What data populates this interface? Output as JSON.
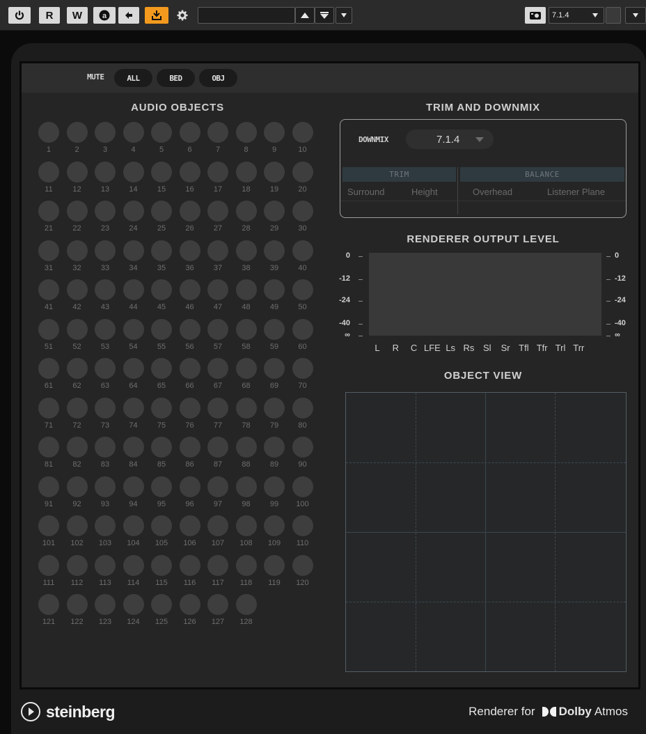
{
  "toolbar": {
    "power_icon": "power-icon",
    "read_label": "R",
    "write_label": "W",
    "automation_icon": "a-circle-icon",
    "side_chain_icon": "arrow-left-icon",
    "monitor_icon": "routing-icon",
    "settings_icon": "gear-icon",
    "preset_value": "",
    "format_value": "7.1.4",
    "camera_icon": "snapshot-icon"
  },
  "mute": {
    "label": "MUTE",
    "buttons": [
      "ALL",
      "BED",
      "OBJ"
    ]
  },
  "audio_objects": {
    "title": "AUDIO OBJECTS",
    "count": 128,
    "columns": 10
  },
  "trim_downmix": {
    "title": "TRIM AND DOWNMIX",
    "downmix_label": "DOWNMIX",
    "downmix_value": "7.1.4",
    "trim_header": "TRIM",
    "balance_header": "BALANCE",
    "trim_columns": [
      "Surround",
      "Height"
    ],
    "balance_columns": [
      "Overhead",
      "Listener Plane"
    ]
  },
  "renderer_output": {
    "title": "RENDERER OUTPUT LEVEL",
    "scale": [
      "0",
      "-12",
      "-24",
      "-40",
      "∞"
    ],
    "channels": [
      "L",
      "R",
      "C",
      "LFE",
      "Ls",
      "Rs",
      "Sl",
      "Sr",
      "Tfl",
      "Tfr",
      "Trl",
      "Trr"
    ]
  },
  "object_view": {
    "title": "OBJECT VIEW"
  },
  "footer": {
    "brand": "steinberg",
    "product_prefix": "Renderer for",
    "dolby": "Dolby",
    "atmos": "Atmos"
  },
  "colors": {
    "accent": "#f39a1e",
    "panel": "#252525",
    "object_dot": "#3e3e3e"
  }
}
